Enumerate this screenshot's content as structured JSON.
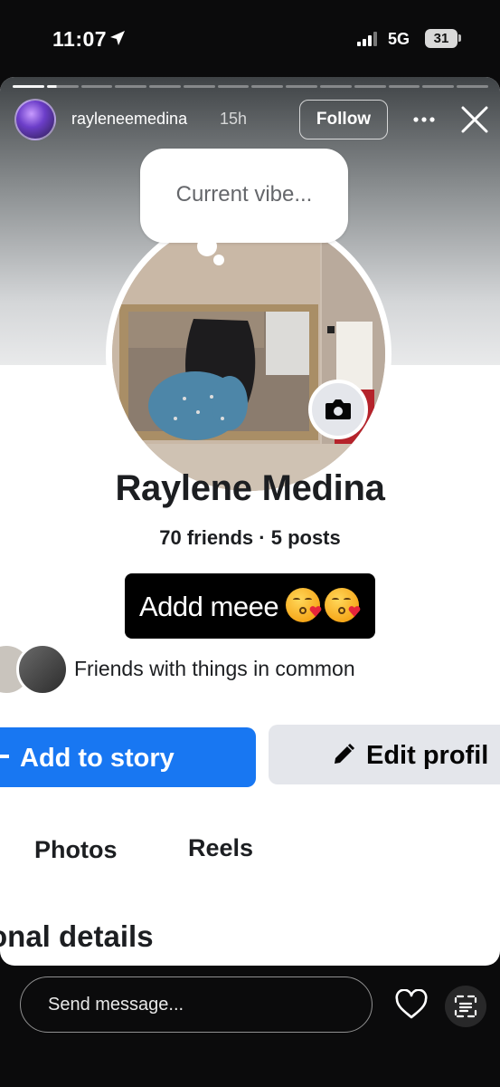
{
  "status_bar": {
    "time": "11:07",
    "network": "5G",
    "battery": "31"
  },
  "story": {
    "username": "rayleneemedina",
    "age": "15h",
    "follow_label": "Follow",
    "progress_total_segments": 14,
    "progress_completed": 2
  },
  "profile": {
    "bubble_text": "Current vibe...",
    "name": "Raylene Medina",
    "stats": "70 friends · 5 posts",
    "bio": "Addd meee",
    "bio_emojis": [
      "kissing-heart-emoji",
      "kissing-heart-emoji"
    ],
    "mutual_text": "Friends with things in common",
    "add_story_label": "Add to story",
    "edit_profile_label": "Edit profil",
    "tabs": [
      "Photos",
      "Reels"
    ],
    "section_title": "onal details"
  },
  "bottom_bar": {
    "message_placeholder": "Send message..."
  },
  "colors": {
    "primary_blue": "#1877f2",
    "secondary_gray": "#e4e6eb",
    "text_dark": "#1c1e21"
  }
}
